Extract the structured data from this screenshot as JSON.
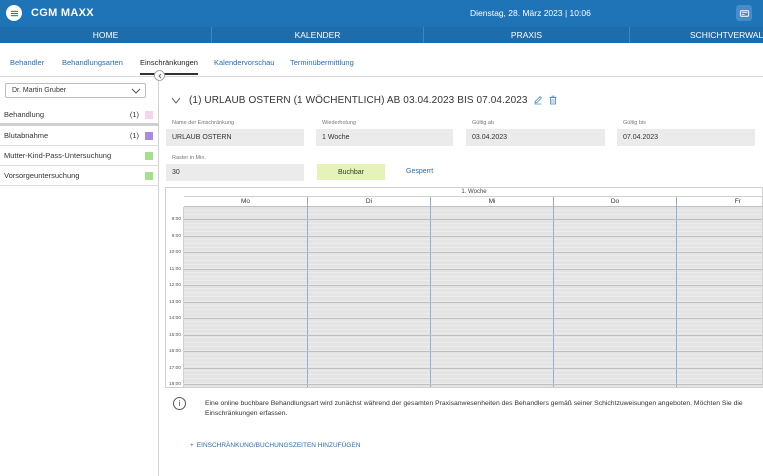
{
  "app": {
    "title": "CGM MAXX",
    "date": "Dienstag, 28. März 2023 | 10:06"
  },
  "icons": {
    "menu": "hamburger-icon",
    "top_right": "card-reader-icon",
    "collapse": "chevron-left-icon",
    "dropdown": "chevron-down-icon",
    "section_toggle": "chevron-down-icon",
    "edit": "pencil-icon",
    "delete": "trash-icon",
    "info": "info-icon",
    "add": "plus-icon"
  },
  "main_nav": [
    {
      "label": "HOME"
    },
    {
      "label": "KALENDER"
    },
    {
      "label": "PRAXIS"
    },
    {
      "label": "SCHICHTVERWALTUNG"
    }
  ],
  "sub_nav": {
    "tabs": [
      {
        "label": "Behandler",
        "active": false
      },
      {
        "label": "Behandlungsarten",
        "active": false
      },
      {
        "label": "Einschränkungen",
        "active": true
      },
      {
        "label": "Kalendervorschau",
        "active": false
      },
      {
        "label": "Terminübermittlung",
        "active": false
      }
    ]
  },
  "sidebar": {
    "selected_practitioner": "Dr. Martin Gruber",
    "items": [
      {
        "label": "Behandlung",
        "count": "(1)",
        "color": "#f5d5ec"
      },
      {
        "label": "Blutabnahme",
        "count": "(1)",
        "color": "#a78be3"
      },
      {
        "label": "Mutter-Kind-Pass-Untersuchung",
        "count": "",
        "color": "#a5e08f"
      },
      {
        "label": "Vorsorgeuntersuchung",
        "count": "",
        "color": "#a5e08f"
      }
    ]
  },
  "restriction": {
    "heading": "(1) URLAUB OSTERN (1 WÖCHENTLICH) AB 03.04.2023 BIS 07.04.2023",
    "fields": {
      "name_label": "Name der Einschränkung",
      "name_value": "URLAUB OSTERN",
      "repeat_label": "Wiederholung",
      "repeat_value": "1 Woche",
      "valid_from_label": "Gültig ab",
      "valid_from_value": "03.04.2023",
      "valid_to_label": "Gültig bis",
      "valid_to_value": "07.04.2023",
      "grid_label": "Raster in Min.",
      "grid_value": "30"
    },
    "bookable_label": "Buchbar",
    "blocked_label": "Gesperrt"
  },
  "calendar": {
    "week_label": "1. Woche",
    "days": [
      "Mo",
      "Di",
      "Mi",
      "Do",
      "Fr"
    ],
    "times": [
      "8:00",
      "9:00",
      "10:00",
      "11:00",
      "12:00",
      "13:00",
      "14:00",
      "15:00",
      "16:00",
      "17:00",
      "18:00"
    ]
  },
  "info_text": "Eine online buchbare Behandlungsart wird zunächst während der gesamten Praxisanwesenheiten des Behandlers gemäß seiner Schichtzuweisungen angeboten. Möchten Sie die Einschränkungen erfassen.",
  "add_link": "EINSCHRÄNKUNG/BUCHUNGSZEITEN HINZUFÜGEN",
  "add_link_plus": "+"
}
